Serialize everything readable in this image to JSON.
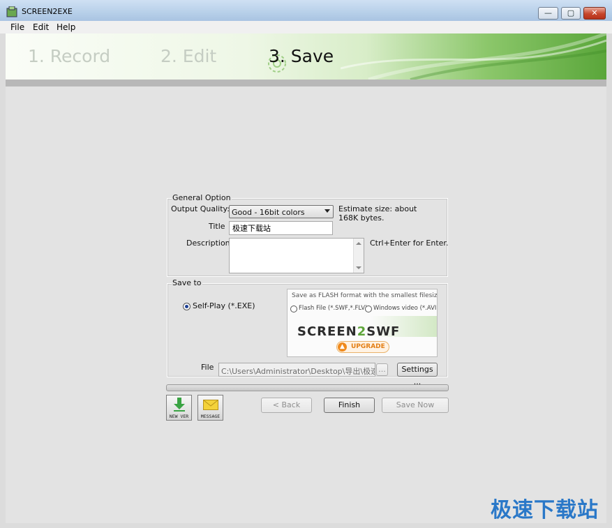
{
  "window": {
    "title": "SCREEN2EXE",
    "controls": {
      "minimize": "—",
      "maximize": "▢",
      "close": "✕"
    }
  },
  "menu": [
    "File",
    "Edit",
    "Help"
  ],
  "steps": [
    "1. Record",
    "2. Edit",
    "3. Save"
  ],
  "active_step": "3. Save",
  "general_option": {
    "legend": "General Option",
    "quality_label": "Output Quality:",
    "quality_value": "Good - 16bit colors",
    "estimate": "Estimate size: about 168K bytes.",
    "title_label": "Title",
    "title_value": "极速下载站",
    "description_label": "Description",
    "description_value": "",
    "description_hint": "Ctrl+Enter for Enter."
  },
  "save_to": {
    "legend": "Save to",
    "option_label": "Self-Play (*.EXE)",
    "option_selected": true,
    "ad": {
      "headline": "Save as FLASH format with the smallest filesize !",
      "option_flash": "Flash File (*.SWF,*.FLV)",
      "option_video": "Windows video (*.AVI)",
      "logo_left": "SCREEN",
      "logo_mid": "2",
      "logo_right": "SWF",
      "upgrade": "UPGRADE"
    },
    "file_label": "File",
    "file_path": "C:\\Users\\Administrator\\Desktop\\导出\\极速下",
    "browse_label": "...",
    "settings_label": "Settings ..."
  },
  "buttons": {
    "back": "< Back",
    "finish": "Finish",
    "save_now": "Save Now",
    "new_ver": "NEW VER",
    "message": "MESSAGE"
  },
  "watermark": "极速下载站",
  "colors": {
    "accent_green": "#5ea53a",
    "upgrade_orange": "#f08a1c",
    "watermark_blue": "#2a78c8"
  }
}
